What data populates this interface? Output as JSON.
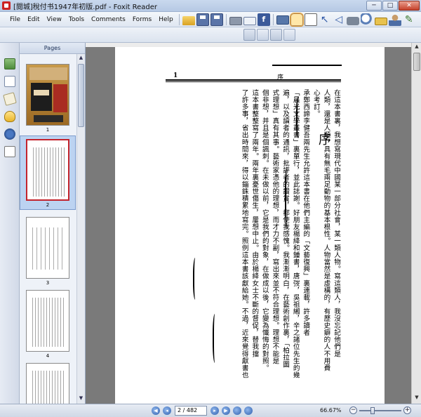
{
  "window": {
    "title": "[閱城]稅付书1947年初版.pdf - Foxit Reader",
    "buttons": {
      "minimize": "─",
      "maximize": "□",
      "close": "✕"
    }
  },
  "menu": {
    "items": [
      "File",
      "Edit",
      "View",
      "Tools",
      "Comments",
      "Forms",
      "Help"
    ]
  },
  "toolbar": {
    "icons": [
      "open-folder-icon",
      "save-icon",
      "save-all-icon",
      "print-icon",
      "email-icon",
      "facebook-icon",
      "fullscreen-icon",
      "hand-tool-icon",
      "select-text-icon",
      "select-tool-icon",
      "back-arrow-icon",
      "forward-arrow-icon",
      "snapshot-icon",
      "zoom-icon",
      "lock-icon",
      "user-icon",
      "pen-icon"
    ],
    "facebook_glyph": "f"
  },
  "pages_panel": {
    "title": "Pages",
    "thumbnails": [
      {
        "number": "1",
        "kind": "cover"
      },
      {
        "number": "2",
        "kind": "text",
        "selected": true
      },
      {
        "number": "3",
        "kind": "text"
      },
      {
        "number": "4",
        "kind": "text"
      },
      {
        "number": "",
        "kind": "text"
      }
    ]
  },
  "document": {
    "page_number": "1",
    "header": "序",
    "big_title": "序",
    "columns": [
      "在這本書裏，我想寫現代中國某一部分社會，某一類人物。寫這類人，我沒忘記他們是",
      "人類，還是人類，具有無毛兩足動物的基本根性。人物當然是虛構的，有歷史癖的人不用費",
      "心考訂。",
      "承鄭西諦李健吾兩先生允許這本書在他們主編的「文藝復興」裏連載，許多讀者",
      "「晨光文學叢書」裏單行，並此誌謝。好朋友楊絳和鍾書，唐弢，吳祖緗，辛之諸位先生的幾",
      "遍，以及讀者的通訊，批評者的讚賞，都使我感愧。我漸漸明白，在藝術創作裏，「柏拉圖",
      "式理想」真有其事。藝術家憑他的理想，而才力不副，寫出來並不符合理想。理想不能是",
      "個非想，并且是個諷刺。在未做以前，它是我們的對象，在做成以後，它變為懺悔的對照。",
      "這本書整整寫了兩年。兩年裏憂世傷生，屢想中止。由於楊絳女士不斷的督促，替我擋",
      "了許多事，省出時間來，得以錙銖積累地寫完。照例這本書該獻給她。不過，近來覺得獻書也"
    ]
  },
  "statusbar": {
    "page_field": "2 / 482",
    "zoom": "66.67%",
    "zoom_minus": "−",
    "zoom_plus": "+",
    "nav": {
      "first": "◀",
      "prev": "◂",
      "next": "▸",
      "last": "▶"
    }
  }
}
